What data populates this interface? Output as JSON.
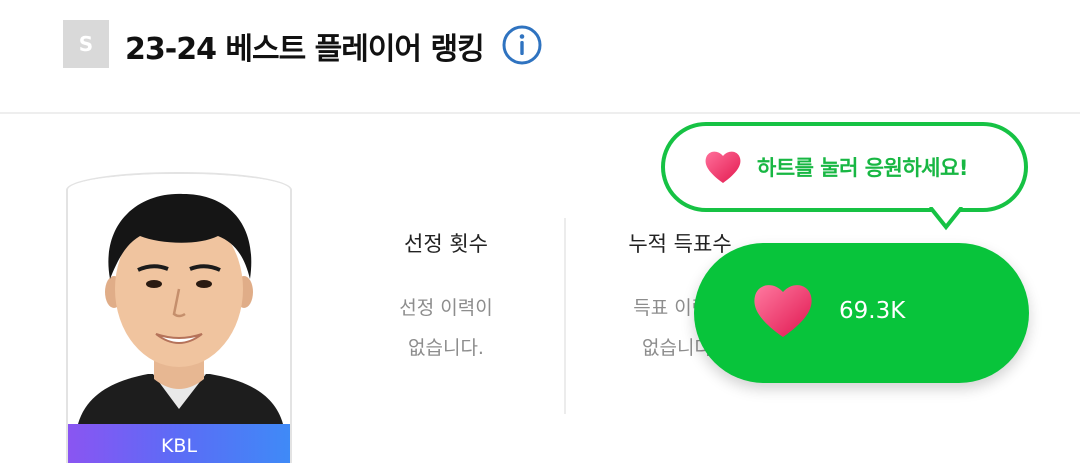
{
  "header": {
    "badge": "S",
    "title": "23-24 베스트 플레이어 랭킹"
  },
  "player": {
    "league": "KBL"
  },
  "stats": [
    {
      "label": "선정 횟수",
      "value_line1": "선정 이력이",
      "value_line2": "없습니다."
    },
    {
      "label": "누적 득표수",
      "value_line1": "득표 이력이",
      "value_line2": "없습니다."
    }
  ],
  "cheer": {
    "tooltip": "하트를 눌러 응원하세요!",
    "count": "69.3K"
  },
  "colors": {
    "accent_green": "#08c43b",
    "tooltip_green": "#16c244",
    "heart_pink": "#f0386b",
    "info_blue": "#2f73c0"
  }
}
